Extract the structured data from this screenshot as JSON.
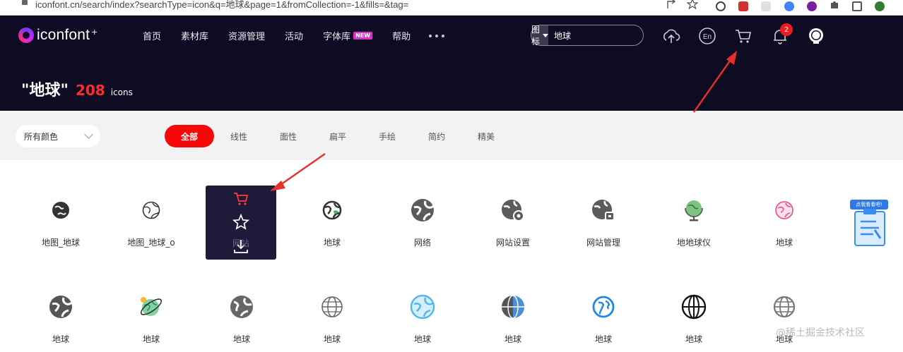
{
  "browser": {
    "url": "iconfont.cn/search/index?searchType=icon&q=地球&page=1&fromCollection=-1&fills=&tag="
  },
  "header": {
    "logo_text": "iconfont",
    "logo_plus": "+",
    "nav": [
      {
        "label": "首页"
      },
      {
        "label": "素材库"
      },
      {
        "label": "资源管理"
      },
      {
        "label": "活动"
      },
      {
        "label": "字体库",
        "badge": "NEW"
      },
      {
        "label": "帮助"
      }
    ],
    "search": {
      "type_label": "图标",
      "value": "地球"
    },
    "notification_count": "2"
  },
  "results": {
    "query": "\"地球\"",
    "count": "208",
    "unit": "icons"
  },
  "filters": {
    "color_select": "所有颜色",
    "styles": [
      {
        "label": "全部",
        "active": true
      },
      {
        "label": "线性"
      },
      {
        "label": "面性"
      },
      {
        "label": "扁平"
      },
      {
        "label": "手绘"
      },
      {
        "label": "简约"
      },
      {
        "label": "精美"
      }
    ]
  },
  "icons": [
    {
      "label": "地图_地球",
      "icon": "globe-solid-icon",
      "color": "#333333"
    },
    {
      "label": "地图_地球_o",
      "icon": "globe-outline-icon",
      "color": "#333333"
    },
    {
      "label": "网站",
      "icon": "globe-hovered-icon",
      "color": "#333333"
    },
    {
      "label": "地球",
      "icon": "globe-outline-bold-icon",
      "color": "#333333"
    },
    {
      "label": "网络",
      "icon": "globe-solid-icon",
      "color": "#5b5b5b"
    },
    {
      "label": "网站设置",
      "icon": "globe-gear-icon",
      "color": "#5b5b5b"
    },
    {
      "label": "网站管理",
      "icon": "globe-lock-icon",
      "color": "#5b5b5b"
    },
    {
      "label": "地地球仪",
      "icon": "desk-globe-icon",
      "color": "#4caf50"
    },
    {
      "label": "地球",
      "icon": "globe-pink-icon",
      "color": "#e84c8a"
    },
    {
      "label": "地球",
      "icon": "globe-solid-icon",
      "color": "#555555"
    },
    {
      "label": "地球",
      "icon": "planet-ring-icon",
      "color": "#3aa36a"
    },
    {
      "label": "地球",
      "icon": "globe-solid-icon",
      "color": "#666666"
    },
    {
      "label": "地球",
      "icon": "globe-grid-icon",
      "color": "#666666"
    },
    {
      "label": "地球",
      "icon": "globe-sky-icon",
      "color": "#4fb6e8"
    },
    {
      "label": "地球",
      "icon": "globe-blue-half-icon",
      "color": "#4a90d9"
    },
    {
      "label": "地球",
      "icon": "globe-blue-icon",
      "color": "#1e88e5"
    },
    {
      "label": "地球",
      "icon": "globe-grid-bold-icon",
      "color": "#111111"
    },
    {
      "label": "地球",
      "icon": "globe-grid-icon",
      "color": "#777777"
    }
  ],
  "side_widget": {
    "tag": "点我看看吧!"
  },
  "watermark": "@稀土掘金技术社区",
  "colors": {
    "header_bg": "#0e0c22",
    "accent": "#f70707",
    "badge": "#f21b1b",
    "new_badge": "#d631c9"
  }
}
